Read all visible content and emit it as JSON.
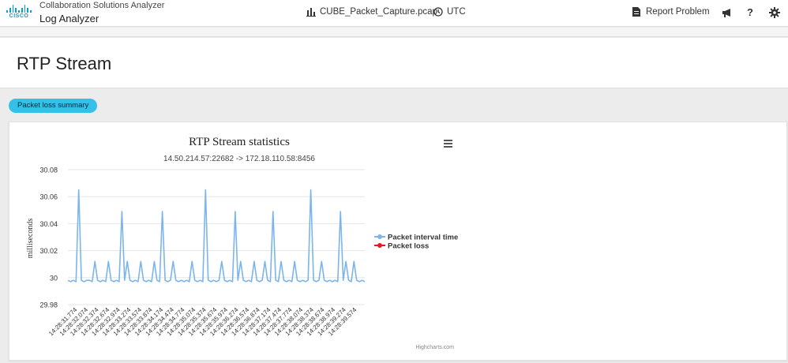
{
  "header": {
    "logo_text": "CISCO",
    "app_title": "Collaboration Solutions Analyzer",
    "app_subtitle": "Log Analyzer",
    "file_name": "CUBE_Packet_Capture.pcap",
    "timezone": "UTC",
    "report_label": "Report Problem",
    "help_label": "?"
  },
  "page": {
    "title": "RTP Stream",
    "summary_button": "Packet loss summary"
  },
  "chart_data": {
    "type": "line",
    "title": "RTP Stream statistics",
    "subtitle": "14.50.214.57:22682 -> 172.18.110.58:8456",
    "ylabel": "milliseconds",
    "xlabel": "",
    "ylim": [
      29.98,
      30.08
    ],
    "yticks": [
      "29.98",
      "30",
      "30.02",
      "30.04",
      "30.06",
      "30.08"
    ],
    "grid": true,
    "legend_position": "right",
    "credit": "Highcharts.com",
    "x_ticks": [
      "14:28:31.774",
      "14:28:32.074",
      "14:28:32.374",
      "14:28:32.674",
      "14:28:32.974",
      "14:28:33.274",
      "14:28:33.574",
      "14:28:33.874",
      "14:28:34.174",
      "14:28:34.474",
      "14:28:34.774",
      "14:28:35.074",
      "14:28:35.374",
      "14:28:35.674",
      "14:28:35.974",
      "14:28:36.274",
      "14:28:36.574",
      "14:28:36.874",
      "14:28:37.174",
      "14:28:37.474",
      "14:28:37.774",
      "14:28:38.074",
      "14:28:38.374",
      "14:28:38.674",
      "14:28:38.974",
      "14:28:39.274",
      "14:28:39.574"
    ],
    "series": [
      {
        "name": "Packet interval time",
        "color": "#7cb5ec",
        "values": [
          29.998,
          29.997,
          29.998,
          29.997,
          30.065,
          29.998,
          29.997,
          29.998,
          29.998,
          29.997,
          30.012,
          29.998,
          29.997,
          29.998,
          29.997,
          30.012,
          29.998,
          29.997,
          29.998,
          29.997,
          30.049,
          29.998,
          30.012,
          29.998,
          29.997,
          29.998,
          29.997,
          30.012,
          29.998,
          29.997,
          29.998,
          29.997,
          30.012,
          29.998,
          29.997,
          30.049,
          29.998,
          29.997,
          29.998,
          30.012,
          29.998,
          29.997,
          29.998,
          29.997,
          29.998,
          29.997,
          30.012,
          29.998,
          29.997,
          29.998,
          29.997,
          30.065,
          29.998,
          29.997,
          29.998,
          29.997,
          29.998,
          30.012,
          29.998,
          29.997,
          29.998,
          29.997,
          30.049,
          29.998,
          30.012,
          29.998,
          29.997,
          29.998,
          29.997,
          30.012,
          29.998,
          29.997,
          29.998,
          30.012,
          29.998,
          29.997,
          30.049,
          29.998,
          29.997,
          30.012,
          29.998,
          29.997,
          29.998,
          29.997,
          30.012,
          29.998,
          29.997,
          29.998,
          29.997,
          29.998,
          30.065,
          29.998,
          29.997,
          29.998,
          30.012,
          29.998,
          29.997,
          29.998,
          29.997,
          29.998,
          29.997,
          30.049,
          29.998,
          30.012,
          29.998,
          29.997,
          30.012,
          29.998,
          29.997,
          29.998,
          29.997
        ]
      },
      {
        "name": "Packet loss",
        "color": "#e41a1c",
        "values": []
      }
    ]
  },
  "colors": {
    "accent": "#34c0e8",
    "brand": "#049fd9",
    "series": "#7cb5ec",
    "loss": "#e41a1c"
  },
  "icons": {
    "chart_icon": "bar-chart-icon",
    "clock_icon": "clock-icon",
    "report_icon": "document-icon",
    "announce_icon": "megaphone-icon",
    "settings_icon": "gear-icon",
    "menu_icon": "hamburger-menu-icon"
  }
}
